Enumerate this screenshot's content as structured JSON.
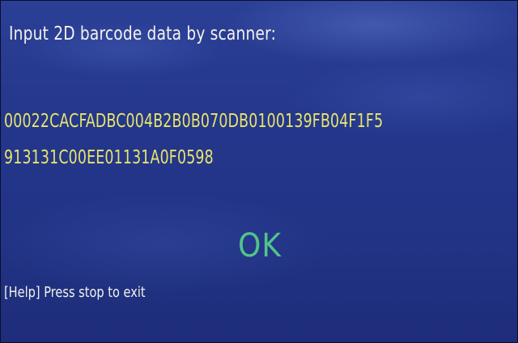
{
  "screen": {
    "prompt": "Input 2D barcode data by scanner:",
    "barcode_line1": "00022CACFADBC004B2B0B070DB0100139FB04F1F5",
    "barcode_line2": "913131C00EE01131A0F0598",
    "status": "OK",
    "help": "[Help] Press stop to exit"
  },
  "colors": {
    "background": "#24378c",
    "prompt_text": "#f3f2ea",
    "barcode_text": "#e9e56a",
    "status_ok": "#50c58a"
  }
}
